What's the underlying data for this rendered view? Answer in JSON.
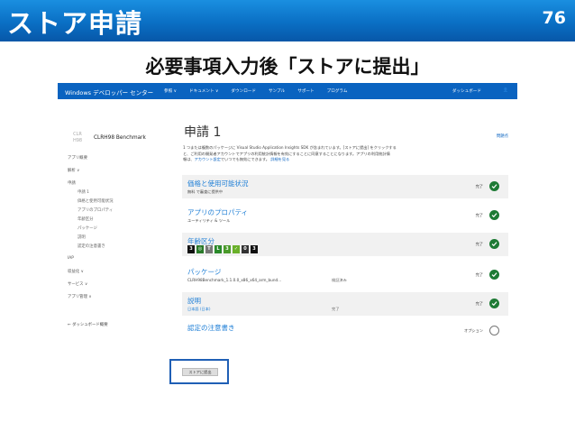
{
  "slide": {
    "title": "ストア申請",
    "number": "76",
    "subtitle": "必要事項入力後「ストアに提出」"
  },
  "navbar": {
    "brand": "Windows デベロッパー センター",
    "menu": [
      "参照 ∨",
      "ドキュメント ∨",
      "ダウンロード",
      "サンプル",
      "サポート",
      "プログラム"
    ],
    "dashboard": "ダッシュボード",
    "user": "👤"
  },
  "app": {
    "logo_text": "CLR H98",
    "name": "CLRH98 Benchmark"
  },
  "sidebar": {
    "items": [
      {
        "label": "アプリ概要",
        "sub": false
      },
      {
        "label": "解析 ∨",
        "sub": false
      },
      {
        "label": "申請",
        "sub": false
      },
      {
        "label": "申請 1",
        "sub": true
      },
      {
        "label": "価格と使用可能状況",
        "sub": true
      },
      {
        "label": "アプリのプロパティ",
        "sub": true
      },
      {
        "label": "年齢区分",
        "sub": true
      },
      {
        "label": "パッケージ",
        "sub": true
      },
      {
        "label": "説明",
        "sub": true
      },
      {
        "label": "認定の注意書き",
        "sub": true
      },
      {
        "label": "IAP",
        "sub": false
      },
      {
        "label": "収益化 ∨",
        "sub": false
      },
      {
        "label": "サービス ∨",
        "sub": false
      },
      {
        "label": "アプリ管理 ∨",
        "sub": false
      }
    ],
    "back_link": "← ダッシュボード概要"
  },
  "main": {
    "title": "申請 1",
    "feedback": "問題点",
    "intro_line1": "1 つまたは複数のパッケージに Visual Studio Application Insights SDK が含まれています。[ストアに提出] をクリックする",
    "intro_line2": "と、ご利用の開発者アカウントでアプリの利用統計情報を有効にすることに同意することになります。アプリの利用統計情",
    "intro_line3": "報は、",
    "intro_link": "アカウント設定",
    "intro_line3b": "でいつでも無効にできます。",
    "intro_link2": "詳細を見る"
  },
  "sections": [
    {
      "title": "価格と使用可能状況",
      "detail": "無料 で審査に提供中",
      "mid": "",
      "status": "完了",
      "done": true,
      "shade": true
    },
    {
      "title": "アプリのプロパティ",
      "detail": "ユーティリティ & ツール",
      "mid": "",
      "status": "完了",
      "done": true,
      "shade": false
    },
    {
      "title": "年齢区分",
      "detail": "",
      "mid": "",
      "status": "完了",
      "done": true,
      "shade": true
    },
    {
      "title": "パッケージ",
      "detail": "CLRH98Benchmark_1.1.0.0_x86_x64_arm_bund...",
      "mid": "検証済み",
      "status": "完了",
      "done": true,
      "shade": false
    },
    {
      "title": "説明",
      "detail": "日本語 (日本)",
      "mid": "完了",
      "status": "完了",
      "done": true,
      "shade": true
    },
    {
      "title": "認定の注意書き",
      "detail": "",
      "mid": "",
      "status": "オプション",
      "done": false,
      "shade": false
    }
  ],
  "ratings": [
    {
      "label": "3",
      "color": "#111111"
    },
    {
      "label": "◎",
      "color": "#2a7a2a"
    },
    {
      "label": "T",
      "color": "#777777"
    },
    {
      "label": "L",
      "color": "#2a8a2a"
    },
    {
      "label": "3",
      "color": "#4a9a2a"
    },
    {
      "label": "✓",
      "color": "#6ab02a"
    },
    {
      "label": "0",
      "color": "#333333"
    },
    {
      "label": "3",
      "color": "#111111"
    }
  ],
  "submit": {
    "label": "ストアに提出"
  },
  "colors": {
    "accent": "#0a63c0",
    "success": "#1d7a34",
    "highlight_box": "#1f5fb5"
  }
}
